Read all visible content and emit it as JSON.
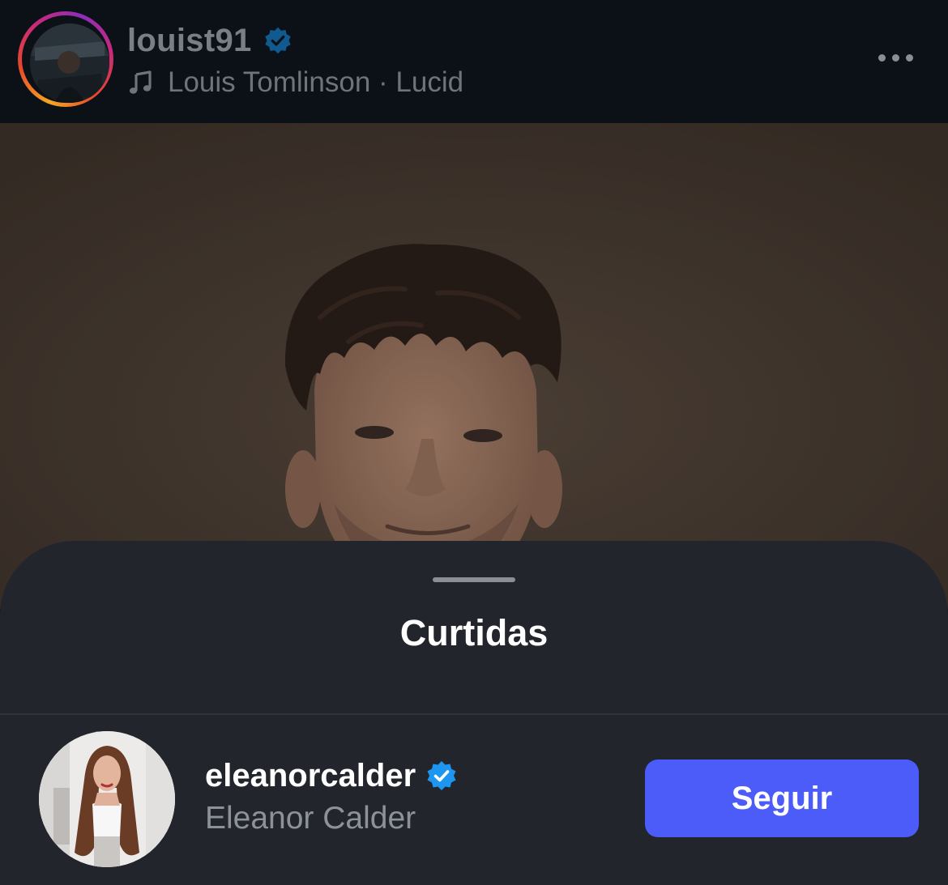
{
  "post_header": {
    "username": "louist91",
    "verified_icon": "verified-badge-icon",
    "music_icon": "music-note-icon",
    "song": "Louis Tomlinson · Lucid",
    "more_icon": "more-options-icon"
  },
  "post_image": {
    "subject": "portrait-photo"
  },
  "likes_sheet": {
    "title": "Curtidas",
    "likers": [
      {
        "username": "eleanorcalder",
        "full_name": "Eleanor Calder",
        "verified": true,
        "follow_label": "Seguir"
      }
    ]
  },
  "colors": {
    "sheet_background": "#22252c",
    "follow_button": "#4b5cf9",
    "verified_blue": "#1c96f0"
  }
}
